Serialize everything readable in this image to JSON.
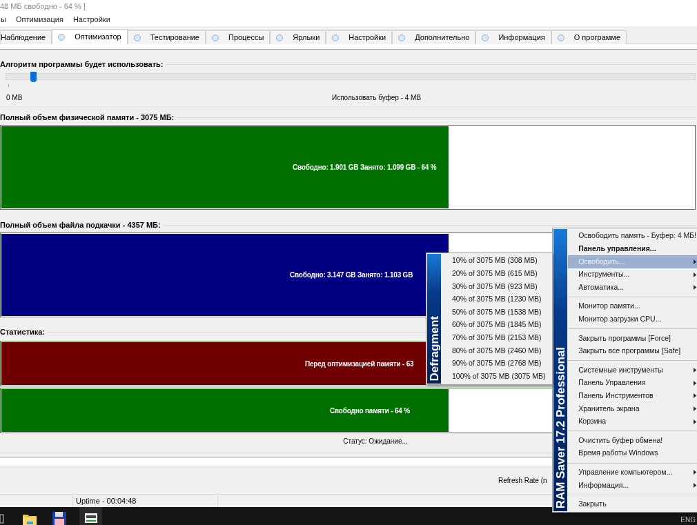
{
  "window": {
    "title": "48 МБ свободно - 64 % ]"
  },
  "menu_bar": [
    "ы",
    "Оптимизация",
    "Настройки"
  ],
  "tabs": [
    {
      "label": "Наблюдение",
      "selected": false,
      "icon": false
    },
    {
      "label": "Оптимизатор",
      "selected": true,
      "icon": true
    },
    {
      "label": "Тестирование",
      "selected": false,
      "icon": true
    },
    {
      "label": "Процессы",
      "selected": false,
      "icon": true
    },
    {
      "label": "Ярлыки",
      "selected": false,
      "icon": true
    },
    {
      "label": "Настройки",
      "selected": false,
      "icon": true
    },
    {
      "label": "Дополнительно",
      "selected": false,
      "icon": true
    },
    {
      "label": "Информация",
      "selected": false,
      "icon": true
    },
    {
      "label": "О программе",
      "selected": false,
      "icon": true
    }
  ],
  "algorithm": {
    "label": "Алгоритм программы будет использовать:",
    "level": 0.035,
    "min_label": "0 MB",
    "value_label": "Использовать буфер - 4 MB"
  },
  "memory_bars": [
    {
      "label": "Полный объем физической памяти - 3075 МБ:",
      "level": 0.645,
      "color": "#007000",
      "text": "Свободно: 1.901 GB  Занято: 1.099 GB - 64 %"
    },
    {
      "label": "Полный объем файла подкачки - 4357 МБ:",
      "level": 0.645,
      "color": "#000080",
      "text": "Свободно: 3.147 GB  Занято: 1.103 GB"
    }
  ],
  "statistics": {
    "label": "Статистика:",
    "bars": [
      {
        "level": 0.645,
        "color": "#700000",
        "text": "Перед оптимизацией памяти - 63"
      },
      {
        "level": 0.645,
        "color": "#007000",
        "text": "Свободно памяти - 64 %"
      }
    ]
  },
  "status": "Статус: Ожидание...",
  "refresh_rate": "Refresh Rate (n",
  "status_bar": {
    "uptime": "Uptime - 00:04:48"
  },
  "context_menu": {
    "banner": "RAM Saver 17.2 Professional",
    "items": [
      {
        "kind": "item",
        "label": "Освободить память - Буфер: 4 МБ!",
        "bold": false,
        "selected": false,
        "submenu": false
      },
      {
        "kind": "item",
        "label": "Панель управления...",
        "bold": true,
        "selected": false,
        "submenu": false
      },
      {
        "kind": "item",
        "label": "Освободить...",
        "bold": false,
        "selected": true,
        "submenu": true
      },
      {
        "kind": "item",
        "label": "Инструменты...",
        "bold": false,
        "selected": false,
        "submenu": true
      },
      {
        "kind": "item",
        "label": "Автоматика...",
        "bold": false,
        "selected": false,
        "submenu": true
      },
      {
        "kind": "separator"
      },
      {
        "kind": "item",
        "label": "Монитор памяти...",
        "bold": false,
        "selected": false,
        "submenu": false
      },
      {
        "kind": "item",
        "label": "Монитор загрузки CPU...",
        "bold": false,
        "selected": false,
        "submenu": false
      },
      {
        "kind": "separator"
      },
      {
        "kind": "item",
        "label": "Закрыть программы [Force]",
        "bold": false,
        "selected": false,
        "submenu": false
      },
      {
        "kind": "item",
        "label": "Закрыть все программы [Safe]",
        "bold": false,
        "selected": false,
        "submenu": false
      },
      {
        "kind": "separator"
      },
      {
        "kind": "item",
        "label": "Системные инструменты",
        "bold": false,
        "selected": false,
        "submenu": true
      },
      {
        "kind": "item",
        "label": "Панель Управления",
        "bold": false,
        "selected": false,
        "submenu": true
      },
      {
        "kind": "item",
        "label": "Панель Инструментов",
        "bold": false,
        "selected": false,
        "submenu": true
      },
      {
        "kind": "item",
        "label": "Хранитель экрана",
        "bold": false,
        "selected": false,
        "submenu": true
      },
      {
        "kind": "item",
        "label": "Корзина",
        "bold": false,
        "selected": false,
        "submenu": true
      },
      {
        "kind": "separator"
      },
      {
        "kind": "item",
        "label": "Очистить буфер обмена!",
        "bold": false,
        "selected": false,
        "submenu": false
      },
      {
        "kind": "item",
        "label": "Время работы Windows",
        "bold": false,
        "selected": false,
        "submenu": false
      },
      {
        "kind": "separator"
      },
      {
        "kind": "item",
        "label": "Управление компьютером...",
        "bold": false,
        "selected": false,
        "submenu": true
      },
      {
        "kind": "item",
        "label": "Информация...",
        "bold": false,
        "selected": false,
        "submenu": true
      },
      {
        "kind": "separator"
      },
      {
        "kind": "item",
        "label": "Закрыть",
        "bold": false,
        "selected": false,
        "submenu": false
      }
    ]
  },
  "submenu": {
    "banner": "Defragment",
    "items": [
      "10% of 3075 MB (308 MB)",
      "20% of 3075 MB (615 MB)",
      "30% of 3075 MB (923 MB)",
      "40% of 3075 MB (1230 MB)",
      "50% of 3075 MB (1538 MB)",
      "60% of 3075 MB (1845 MB)",
      "70% of 3075 MB (2153 MB)",
      "80% of 3075 MB (2460 MB)",
      "90% of 3075 MB (2768 MB)",
      "100% of 3075 MB (3075 MB)"
    ]
  },
  "tray": {
    "language": "ENG"
  }
}
